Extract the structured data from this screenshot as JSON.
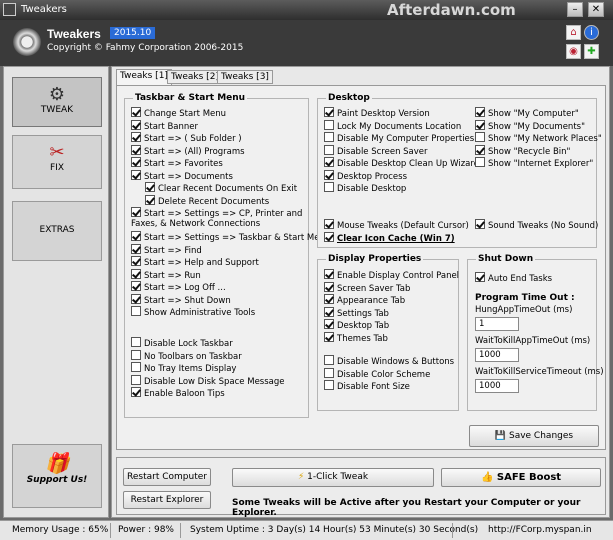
{
  "window": {
    "title": "Tweakers",
    "watermark": "Afterdawn.com"
  },
  "header": {
    "app_name": "Tweakers",
    "version": "2015.10",
    "copyright": "Copyright © Fahmy Corporation 2006-2015"
  },
  "sidebar": {
    "items": [
      {
        "label": "TWEAK",
        "icon": "gear-icon"
      },
      {
        "label": "FIX",
        "icon": "tools-icon"
      },
      {
        "label": "EXTRAS",
        "icon": ""
      },
      {
        "label": "Support Us!",
        "icon": "gift-icon"
      }
    ]
  },
  "tabs": [
    "Tweaks [1]",
    "Tweaks [2]",
    "Tweaks [3]"
  ],
  "taskbar": {
    "title": "Taskbar & Start Menu",
    "items": [
      {
        "label": "Change Start Menu",
        "checked": true
      },
      {
        "label": "Start Banner",
        "checked": true
      },
      {
        "label": "Start => ( Sub Folder )",
        "checked": true
      },
      {
        "label": "Start => (All) Programs",
        "checked": true
      },
      {
        "label": "Start => Favorites",
        "checked": true
      },
      {
        "label": "Start => Documents",
        "checked": true
      },
      {
        "label": "Clear Recent Documents On Exit",
        "checked": true
      },
      {
        "label": "Delete Recent Documents",
        "checked": true
      },
      {
        "label": "Start => Settings => CP, Printer and Faxes, & Network Connections",
        "checked": true
      },
      {
        "label": "Start => Settings => Taskbar & Start Menu",
        "checked": true
      },
      {
        "label": "Start => Find",
        "checked": true
      },
      {
        "label": "Start => Help and Support",
        "checked": true
      },
      {
        "label": "Start => Run",
        "checked": true
      },
      {
        "label": "Start => Log Off ...",
        "checked": true
      },
      {
        "label": "Start => Shut Down",
        "checked": true
      },
      {
        "label": "Show Administrative Tools",
        "checked": false
      },
      {
        "label": "Disable Lock Taskbar",
        "checked": false
      },
      {
        "label": "No Toolbars on Taskbar",
        "checked": false
      },
      {
        "label": "No Tray Items Display",
        "checked": false
      },
      {
        "label": "Disable Low Disk Space Message",
        "checked": false
      },
      {
        "label": "Enable Baloon Tips",
        "checked": true
      }
    ]
  },
  "desktop": {
    "title": "Desktop",
    "left": [
      {
        "label": "Paint Desktop Version",
        "checked": true
      },
      {
        "label": "Lock My Documents Location",
        "checked": false
      },
      {
        "label": "Disable My Computer Properties",
        "checked": false
      },
      {
        "label": "Disable Screen Saver",
        "checked": false
      },
      {
        "label": "Disable Desktop Clean Up Wizard",
        "checked": true
      },
      {
        "label": "Desktop Process",
        "checked": true
      },
      {
        "label": "Disable Desktop",
        "checked": false
      }
    ],
    "right": [
      {
        "label": "Show \"My Computer\"",
        "checked": true
      },
      {
        "label": "Show \"My Documents\"",
        "checked": true
      },
      {
        "label": "Show \"My Network Places\"",
        "checked": false
      },
      {
        "label": "Show \"Recycle Bin\"",
        "checked": true
      },
      {
        "label": "Show \"Internet Explorer\"",
        "checked": false
      }
    ],
    "mouse_tweaks": {
      "label": "Mouse Tweaks (Default Cursor)",
      "checked": true
    },
    "sound_tweaks": {
      "label": "Sound Tweaks (No Sound)",
      "checked": true
    },
    "icon_cache": {
      "label": "Clear Icon Cache (Win 7)",
      "checked": true
    }
  },
  "display": {
    "title": "Display Properties",
    "items": [
      {
        "label": "Enable Display Control Panel",
        "checked": true
      },
      {
        "label": "Screen Saver Tab",
        "checked": true
      },
      {
        "label": "Appearance Tab",
        "checked": true
      },
      {
        "label": "Settings Tab",
        "checked": true
      },
      {
        "label": "Desktop Tab",
        "checked": true
      },
      {
        "label": "Themes Tab",
        "checked": true
      },
      {
        "label": "Disable Windows & Buttons",
        "checked": false
      },
      {
        "label": "Disable Color Scheme",
        "checked": false
      },
      {
        "label": "Disable Font Size",
        "checked": false
      }
    ]
  },
  "shutdown": {
    "title": "Shut Down",
    "auto_end": {
      "label": "Auto End Tasks",
      "checked": true
    },
    "timeout_title": "Program Time Out :",
    "fields": [
      {
        "label": "HungAppTimeOut (ms)",
        "value": "1"
      },
      {
        "label": "WaitToKillAppTimeOut (ms)",
        "value": "1000"
      },
      {
        "label": "WaitToKillServiceTimeout (ms)",
        "value": "1000"
      }
    ]
  },
  "buttons": {
    "save": "Save Changes",
    "restart_computer": "Restart Computer",
    "restart_explorer": "Restart Explorer",
    "one_click": "1-Click Tweak",
    "safe_boost": "SAFE Boost"
  },
  "note": "Some Tweaks will be Active after you Restart your Computer or your Explorer.",
  "status": {
    "memory": "Memory Usage : 65%",
    "power": "Power : 98%",
    "uptime": "System Uptime : 3 Day(s) 14 Hour(s) 53 Minute(s) 30 Second(s)",
    "url": "http://FCorp.myspan.in"
  }
}
